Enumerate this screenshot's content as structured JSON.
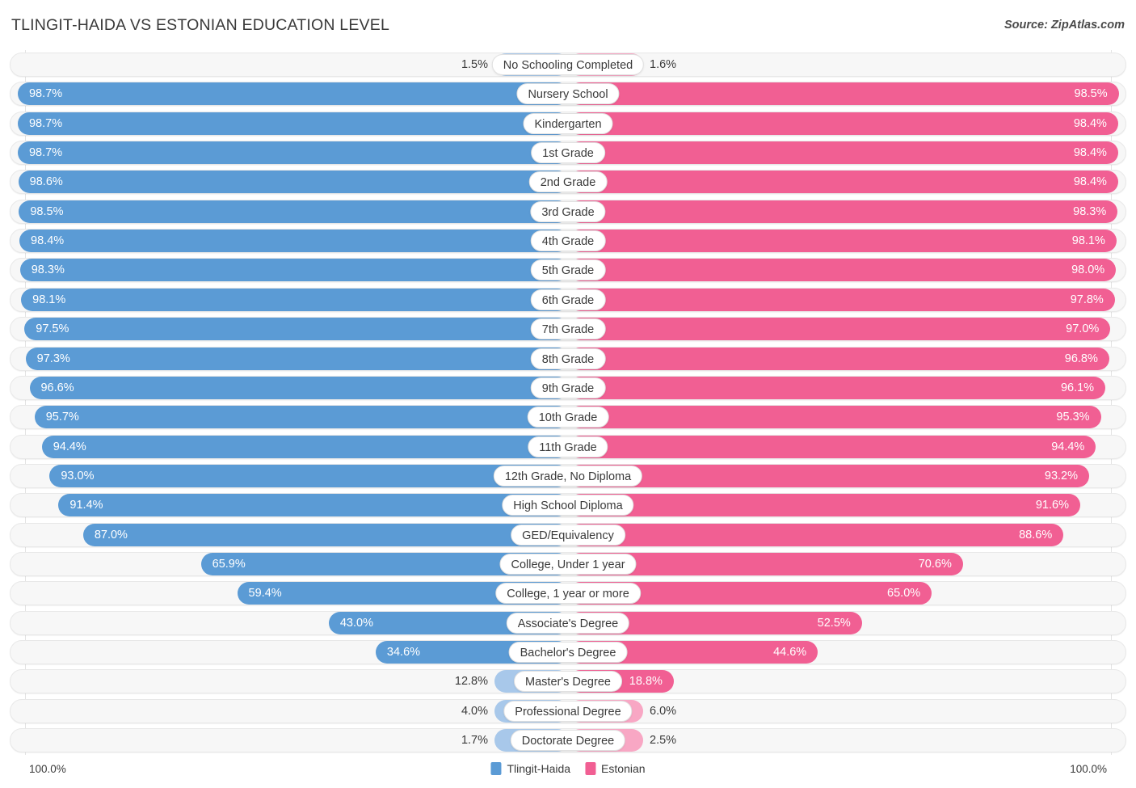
{
  "header": {
    "title": "TLINGIT-HAIDA VS ESTONIAN EDUCATION LEVEL",
    "source": "Source: ZipAtlas.com"
  },
  "footer": {
    "axis_min": "100.0%",
    "axis_max": "100.0%",
    "legend": [
      {
        "label": "Tlingit-Haida",
        "color": "#5b9bd5"
      },
      {
        "label": "Estonian",
        "color": "#f15f93"
      }
    ]
  },
  "colors": {
    "left_dark": "#5b9bd5",
    "left_light": "#a8c8ea",
    "right_dark": "#f15f93",
    "right_light": "#f8a7c4",
    "track": "#f7f7f7"
  },
  "chart_data": {
    "type": "bar",
    "title": "TLINGIT-HAIDA VS ESTONIAN EDUCATION LEVEL",
    "subtitle": "Source: ZipAtlas.com",
    "orientation": "horizontal-diverging",
    "xlabel": "",
    "ylabel": "",
    "xlim": [
      0,
      100
    ],
    "grid": false,
    "legend_position": "bottom-center",
    "axis_tick_labels": [
      "100.0%",
      "100.0%"
    ],
    "categories": [
      "No Schooling Completed",
      "Nursery School",
      "Kindergarten",
      "1st Grade",
      "2nd Grade",
      "3rd Grade",
      "4th Grade",
      "5th Grade",
      "6th Grade",
      "7th Grade",
      "8th Grade",
      "9th Grade",
      "10th Grade",
      "11th Grade",
      "12th Grade, No Diploma",
      "High School Diploma",
      "GED/Equivalency",
      "College, Under 1 year",
      "College, 1 year or more",
      "Associate's Degree",
      "Bachelor's Degree",
      "Master's Degree",
      "Professional Degree",
      "Doctorate Degree"
    ],
    "series": [
      {
        "name": "Tlingit-Haida",
        "color": "#5b9bd5",
        "values": [
          1.5,
          98.7,
          98.7,
          98.7,
          98.6,
          98.5,
          98.4,
          98.3,
          98.1,
          97.5,
          97.3,
          96.6,
          95.7,
          94.4,
          93.0,
          91.4,
          87.0,
          65.9,
          59.4,
          43.0,
          34.6,
          12.8,
          4.0,
          1.7
        ],
        "labels": [
          "1.5%",
          "98.7%",
          "98.7%",
          "98.7%",
          "98.6%",
          "98.5%",
          "98.4%",
          "98.3%",
          "98.1%",
          "97.5%",
          "97.3%",
          "96.6%",
          "95.7%",
          "94.4%",
          "93.0%",
          "91.4%",
          "87.0%",
          "65.9%",
          "59.4%",
          "43.0%",
          "34.6%",
          "12.8%",
          "4.0%",
          "1.7%"
        ]
      },
      {
        "name": "Estonian",
        "color": "#f15f93",
        "values": [
          1.6,
          98.5,
          98.4,
          98.4,
          98.4,
          98.3,
          98.1,
          98.0,
          97.8,
          97.0,
          96.8,
          96.1,
          95.3,
          94.4,
          93.2,
          91.6,
          88.6,
          70.6,
          65.0,
          52.5,
          44.6,
          18.8,
          6.0,
          2.5
        ],
        "labels": [
          "1.6%",
          "98.5%",
          "98.4%",
          "98.4%",
          "98.4%",
          "98.3%",
          "98.1%",
          "98.0%",
          "97.8%",
          "97.0%",
          "96.8%",
          "96.1%",
          "95.3%",
          "94.4%",
          "93.2%",
          "91.6%",
          "88.6%",
          "70.6%",
          "65.0%",
          "52.5%",
          "44.6%",
          "18.8%",
          "6.0%",
          "2.5%"
        ]
      }
    ]
  }
}
